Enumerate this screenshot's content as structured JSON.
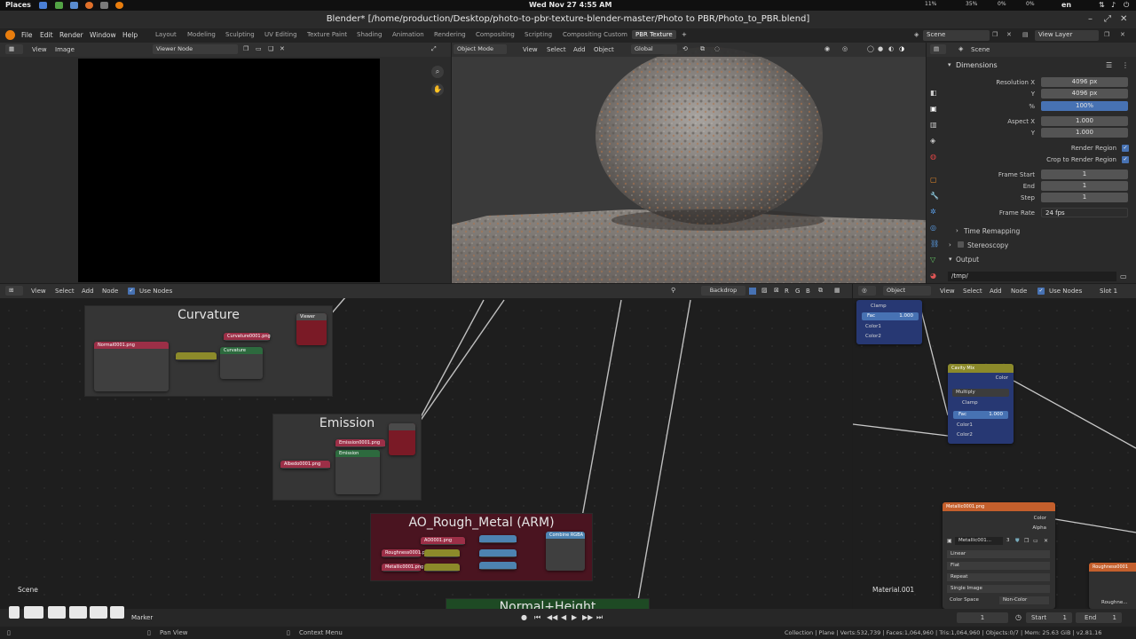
{
  "os": {
    "places": "Places",
    "clock": "Wed Nov 27   4:55 AM",
    "lang": "en",
    "tray": [
      "11%",
      "35%",
      "0%",
      "0%"
    ]
  },
  "window": {
    "title": "Blender* [/home/production/Desktop/photo-to-pbr-texture-blender-master/Photo to PBR/Photo_to_PBR.blend]"
  },
  "menubar": {
    "menus": [
      "File",
      "Edit",
      "Render",
      "Window",
      "Help"
    ],
    "workspaces": [
      "Layout",
      "Modeling",
      "Sculpting",
      "UV Editing",
      "Texture Paint",
      "Shading",
      "Animation",
      "Rendering",
      "Compositing",
      "Scripting",
      "Compositing Custom",
      "PBR Texture"
    ],
    "active_workspace": "PBR Texture",
    "add_tab": "+",
    "scene": "Scene",
    "view_layer": "View Layer"
  },
  "image_editor": {
    "menus": [
      "View",
      "Image"
    ],
    "image_name": "Viewer Node"
  },
  "viewport": {
    "mode": "Object Mode",
    "menus": [
      "View",
      "Select",
      "Add",
      "Object"
    ],
    "orientation": "Global"
  },
  "properties": {
    "header": "Scene",
    "section": "Dimensions",
    "rows": [
      {
        "label": "Resolution X",
        "value": "4096 px"
      },
      {
        "label": "Y",
        "value": "4096 px"
      },
      {
        "label": "%",
        "value": "100%"
      },
      {
        "label": "Aspect X",
        "value": "1.000"
      },
      {
        "label": "Y",
        "value": "1.000"
      },
      {
        "label": "Frame Start",
        "value": "1"
      },
      {
        "label": "End",
        "value": "1"
      },
      {
        "label": "Step",
        "value": "1"
      },
      {
        "label": "Frame Rate",
        "value": "24 fps"
      }
    ],
    "render_region": "Render Region",
    "crop_region": "Crop to Render Region",
    "time_remapping": "Time Remapping",
    "stereoscopy": "Stereoscopy",
    "output": "Output",
    "output_path": "/tmp/"
  },
  "node_editor_left": {
    "menus": [
      "View",
      "Select",
      "Add",
      "Node"
    ],
    "use_nodes": "Use Nodes",
    "backdrop": "Backdrop",
    "channels": [
      "R",
      "G",
      "B"
    ],
    "scene_label": "Scene",
    "frames": [
      {
        "title": "Curvature"
      },
      {
        "title": "Emission"
      },
      {
        "title": "AO_Rough_Metal (ARM)"
      },
      {
        "title": "Normal+Height"
      }
    ],
    "node_labels": {
      "normal_png": "Normal0001.png",
      "curvature_png": "Curvature0001.png",
      "curvature": "Curvature",
      "viewer": "Viewer",
      "emission_png": "Emission0001.png",
      "albedo_png": "Albedo0001.png",
      "emission": "Emission",
      "arm_ao": "AO0001.png",
      "arm_rough": "Roughness0001.png",
      "arm_metal": "Metallic0001.png",
      "combine": "Combine RGBA"
    }
  },
  "node_editor_right": {
    "object": "Object",
    "menus": [
      "View",
      "Select",
      "Add",
      "Node"
    ],
    "use_nodes": "Use Nodes",
    "slot": "Slot 1",
    "top_node": {
      "clamp": "Clamp",
      "fac": "Fac",
      "fac_value": "1.000",
      "color1": "Color1",
      "color2": "Color2"
    },
    "cavity_mix": {
      "title": "Cavity Mix",
      "out": "Color",
      "mode": "Multiply",
      "clamp": "Clamp",
      "fac": "Fac",
      "fac_value": "1.000",
      "color1": "Color1",
      "color2": "Color2"
    },
    "metallic_node": {
      "title": "Metallic0001.png",
      "color": "Color",
      "alpha": "Alpha",
      "image": "Metallic001...",
      "users": "3",
      "interp": "Linear",
      "proj": "Flat",
      "ext": "Repeat",
      "source": "Single Image",
      "colorspace_label": "Color Space",
      "colorspace": "Non-Color"
    },
    "roughness_node": {
      "title": "Roughness0001",
      "image": "Roughne..."
    },
    "material_label": "Material.001"
  },
  "timeline": {
    "marker": "Marker",
    "current_frame": "1",
    "start_label": "Start",
    "start": "1",
    "end_label": "End",
    "end": "1"
  },
  "status": {
    "left": "Pan View",
    "middle": "Context Menu",
    "right": "Collection | Plane | Verts:532,739 | Faces:1,064,960 | Tris:1,064,960 | Objects:0/7 | Mem: 25.63 GiB | v2.81.16"
  }
}
